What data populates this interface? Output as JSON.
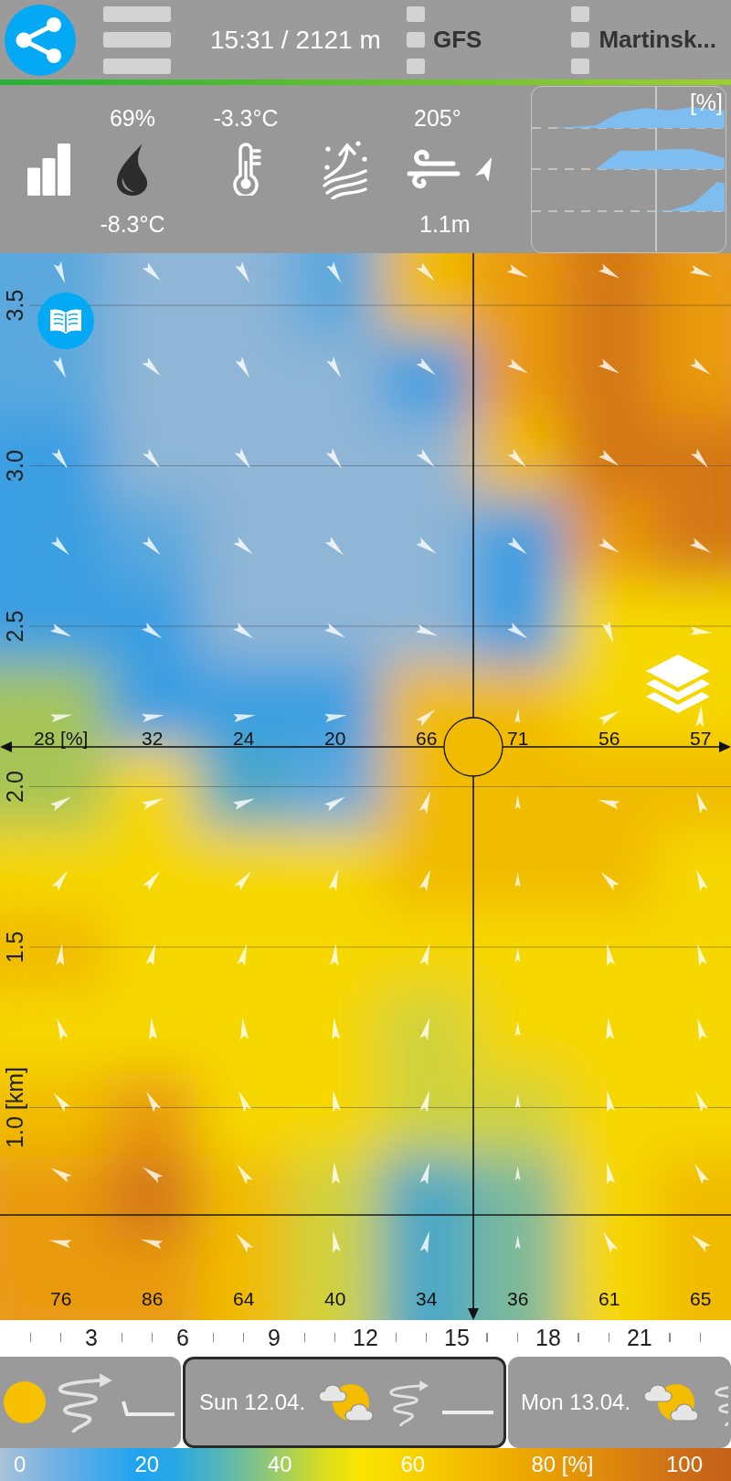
{
  "top_bar": {
    "time_altitude": "15:31 / 2121 m",
    "model": "GFS",
    "location": "Martinsk..."
  },
  "info_panel": {
    "humidity": "69%",
    "dew_point": "-8.3°C",
    "temperature": "-3.3°C",
    "wind_direction": "205°",
    "wind_value": "1.1m",
    "chart": {
      "unit": "[%]"
    }
  },
  "profile": {
    "altitude_labels": [
      "3.5",
      "3.0",
      "2.5",
      "2.0",
      "1.5",
      "1.0 [km]"
    ],
    "crosshair_values": [
      "28 [%]",
      "32",
      "24",
      "20",
      "66",
      "71",
      "56",
      "57"
    ],
    "bottom_values": [
      "76",
      "86",
      "64",
      "40",
      "34",
      "36",
      "61",
      "65"
    ]
  },
  "time_axis": {
    "labels": [
      "3",
      "6",
      "9",
      "12",
      "15",
      "18",
      "21"
    ]
  },
  "days": [
    {
      "selected": false,
      "cloudy": false,
      "thermal": true,
      "step_line": true
    },
    {
      "date": "Sun 12.04.",
      "selected": true,
      "cloudy": true,
      "thermal": true,
      "step_line": false
    },
    {
      "date": "Mon 13.04.",
      "selected": false,
      "cloudy": true,
      "thermal": true
    }
  ],
  "color_scale": {
    "labels": [
      "0",
      "20",
      "40",
      "60",
      "80 [%]",
      "100"
    ]
  }
}
